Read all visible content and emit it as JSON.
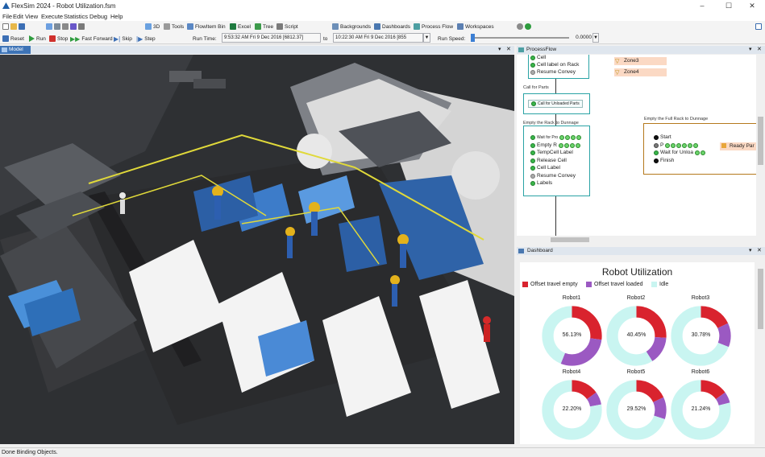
{
  "window": {
    "title": "FlexSim 2024 - Robot Utilization.fsm",
    "minimize": "–",
    "maximize": "☐",
    "close": "✕"
  },
  "menu": [
    "File",
    "Edit",
    "View",
    "Execute",
    "Statistics",
    "Debug",
    "Help"
  ],
  "toolbar": {
    "d3": "3D",
    "tools": "Tools",
    "flowitem_bin": "FlowItem Bin",
    "excel": "Excel",
    "tree": "Tree",
    "script": "Script",
    "backgrounds": "Backgrounds",
    "dashboards": "Dashboards",
    "process_flow": "Process Flow",
    "workspaces": "Workspaces"
  },
  "runbar": {
    "reset": "Reset",
    "run": "Run",
    "stop": "Stop",
    "fast_forward": "Fast Forward",
    "skip": "Skip",
    "step": "Step",
    "run_time_label": "Run Time:",
    "run_time_value": "9:53:32 AM  Fri 9 Dec 2016  [6812.37]",
    "to_label": "to",
    "stop_time_value": "10:22:30 AM  Fri 9 Dec 2016  [855",
    "run_speed_label": "Run Speed:",
    "run_speed_value": "0.0000"
  },
  "model_tab": {
    "label": "Model"
  },
  "process_flow": {
    "tab_label": "ProcessFlow",
    "top_rows": [
      "Cell",
      "Cell label on Rack",
      "Resume Convey"
    ],
    "zones": [
      "Zone3",
      "Zone4"
    ],
    "call_caption": "Call for Parts",
    "call_activity": "Call for Unloaded Parts",
    "dunnage_caption": "Empty the Rack to Dunnage",
    "dunnage_rows": [
      "Wait for Pro",
      "Empty R",
      "TempCell Label",
      "Release Cell",
      "Cell Label",
      "Resume Convey",
      "Labels"
    ],
    "full_caption": "Empty the Full Rack to Dunnage",
    "full_rows": [
      "Start",
      "P",
      "Wait for Unloa",
      "Finish"
    ],
    "ready_label": "Ready Par"
  },
  "dashboard": {
    "tab_label": "Dashboard",
    "title": "Robot Utilization",
    "legend": [
      {
        "label": "Offset travel empty",
        "color": "#d9232e"
      },
      {
        "label": "Offset travel loaded",
        "color": "#9b59c2"
      },
      {
        "label": "Idle",
        "color": "#c9f5f1"
      }
    ],
    "robots": [
      {
        "name": "Robot1",
        "empty": 0.27,
        "loaded": 0.29,
        "idle": 0.44,
        "center": "56.13%"
      },
      {
        "name": "Robot2",
        "empty": 0.26,
        "loaded": 0.15,
        "idle": 0.59,
        "center": "40.45%"
      },
      {
        "name": "Robot3",
        "empty": 0.18,
        "loaded": 0.13,
        "idle": 0.69,
        "center": "30.78%"
      },
      {
        "name": "Robot4",
        "empty": 0.15,
        "loaded": 0.07,
        "idle": 0.78,
        "center": "22.20%"
      },
      {
        "name": "Robot5",
        "empty": 0.18,
        "loaded": 0.12,
        "idle": 0.7,
        "center": "29.52%"
      },
      {
        "name": "Robot6",
        "empty": 0.15,
        "loaded": 0.06,
        "idle": 0.79,
        "center": "21.24%"
      }
    ]
  },
  "status": {
    "text": "Done Binding Objects."
  }
}
